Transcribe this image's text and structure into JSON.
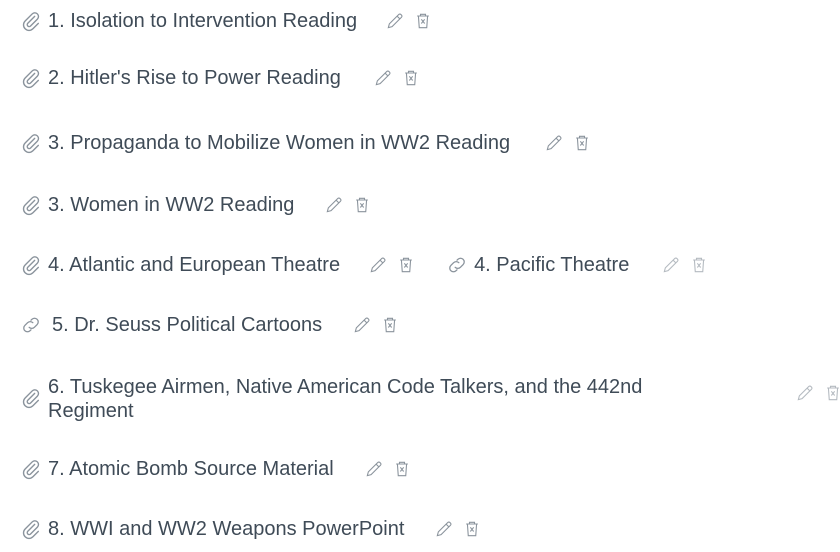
{
  "items": [
    {
      "label": "1. Isolation to Intervention Reading",
      "icon": "paperclip-icon"
    },
    {
      "label": "2. Hitler's Rise to Power Reading",
      "icon": "paperclip-icon"
    },
    {
      "label": "3. Propaganda to Mobilize Women in WW2 Reading",
      "icon": "paperclip-icon"
    },
    {
      "label": "3. Women in WW2 Reading",
      "icon": "paperclip-icon"
    },
    {
      "label": "4. Atlantic and European Theatre",
      "icon": "paperclip-icon"
    },
    {
      "label": "4. Pacific Theatre",
      "icon": "link-icon"
    },
    {
      "label": "5. Dr. Seuss Political Cartoons",
      "icon": "link-icon"
    },
    {
      "label": "6. Tuskegee Airmen, Native American Code Talkers, and the 442nd Regiment",
      "icon": "paperclip-icon"
    },
    {
      "label": "7. Atomic Bomb Source Material",
      "icon": "paperclip-icon"
    },
    {
      "label": "8. WWI and WW2 Weapons PowerPoint",
      "icon": "paperclip-icon"
    }
  ],
  "colors": {
    "text": "#3f4b57",
    "icon": "#8a939c"
  }
}
